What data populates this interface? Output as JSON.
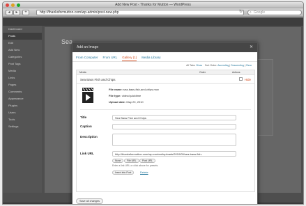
{
  "window": {
    "title": "Add New Post ‹ Thanks for Mutton — WordPress",
    "url": "http://thanksformutton.com/wp-admin/post-new.php",
    "search_placeholder": "Google"
  },
  "sidebar": {
    "items": [
      {
        "label": "Dashboard"
      },
      {
        "label": "Posts"
      },
      {
        "label": "Edit"
      },
      {
        "label": "Add New"
      },
      {
        "label": "Categories"
      },
      {
        "label": "Post Tags"
      },
      {
        "label": "Media"
      },
      {
        "label": "Links"
      },
      {
        "label": "Pages"
      },
      {
        "label": "Comments"
      },
      {
        "label": "Appearance"
      },
      {
        "label": "Plugins"
      },
      {
        "label": "Users"
      },
      {
        "label": "Tools"
      },
      {
        "label": "Settings"
      }
    ]
  },
  "background": {
    "post_title": "Sea"
  },
  "modal": {
    "title": "Add an Image",
    "close_symbol": "✕",
    "tabs": [
      {
        "label": "From Computer"
      },
      {
        "label": "From URL"
      },
      {
        "label": "Gallery (1)"
      },
      {
        "label": "Media Library"
      }
    ],
    "filter": {
      "all_tabs_label": "All Tabs:",
      "show_link": "Show",
      "sort_label": "Sort Order:",
      "ascending": "Ascending",
      "descending": "Descending",
      "clear": "Clear"
    },
    "table_headers": {
      "media": "Media",
      "order": "Order",
      "actions": "Actions"
    },
    "item": {
      "title": "Sea Bass Fish and Chips",
      "hide_label": "Hide",
      "file_name_label": "File name:",
      "file_name": "sea-bass-fish-and-chips.mov",
      "file_type_label": "File type:",
      "file_type": "video/quicktime",
      "upload_date_label": "Upload date:",
      "upload_date": "May 20, 2010"
    },
    "fields": {
      "title_label": "Title",
      "title_value": "Sea Bass Fish and Chips",
      "caption_label": "Caption",
      "caption_value": "",
      "description_label": "Description",
      "description_value": "",
      "link_url_label": "Link URL",
      "link_url_value": "http://thanksformutton.com/wp-content/uploads/2010/05/sea-bass-fish-"
    },
    "url_buttons": {
      "none": "None",
      "file_url": "File URL",
      "post_url": "Post URL"
    },
    "link_hint": "Enter a link URL or click above for presets.",
    "insert_button": "Insert into Post",
    "delete_link": "Delete",
    "save_all_button": "Save all changes"
  },
  "colors": {
    "tab_link": "#21759b",
    "tab_active": "#d54e21",
    "modal_header": "#464646"
  }
}
